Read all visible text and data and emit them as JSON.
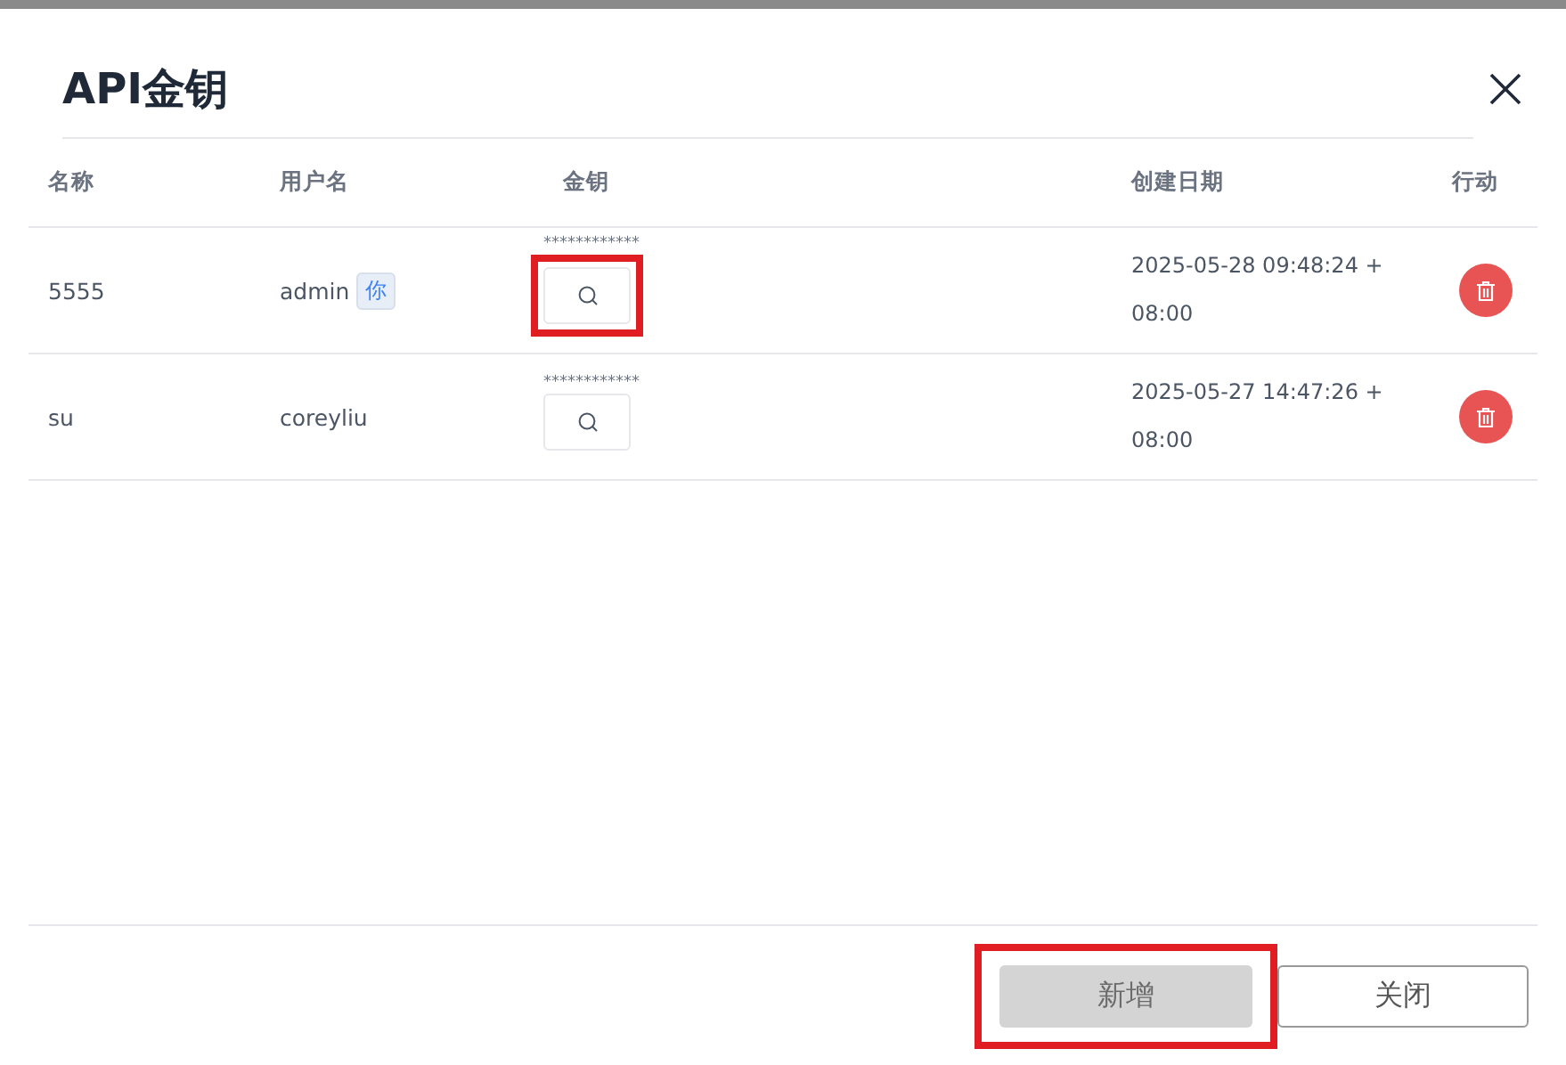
{
  "dialog": {
    "title": "API金钥"
  },
  "table": {
    "columns": [
      "名称",
      "用户名",
      "金钥",
      "创建日期",
      "行动"
    ],
    "rows": [
      {
        "name": "5555",
        "user": "admin",
        "badge": "你",
        "key": "************",
        "key_highlighted": true,
        "created": "2025-05-28 09:48:24 + 08:00"
      },
      {
        "name": "su",
        "user": "coreyliu",
        "key": "************",
        "key_highlighted": false,
        "created": "2025-05-27 14:47:26 + 08:00"
      }
    ]
  },
  "buttons": [
    {
      "label": "新增",
      "kind": "primary",
      "disabled": true,
      "highlighted": true
    },
    {
      "label": "关闭",
      "kind": "secondary",
      "disabled": false,
      "highlighted": false
    }
  ]
}
